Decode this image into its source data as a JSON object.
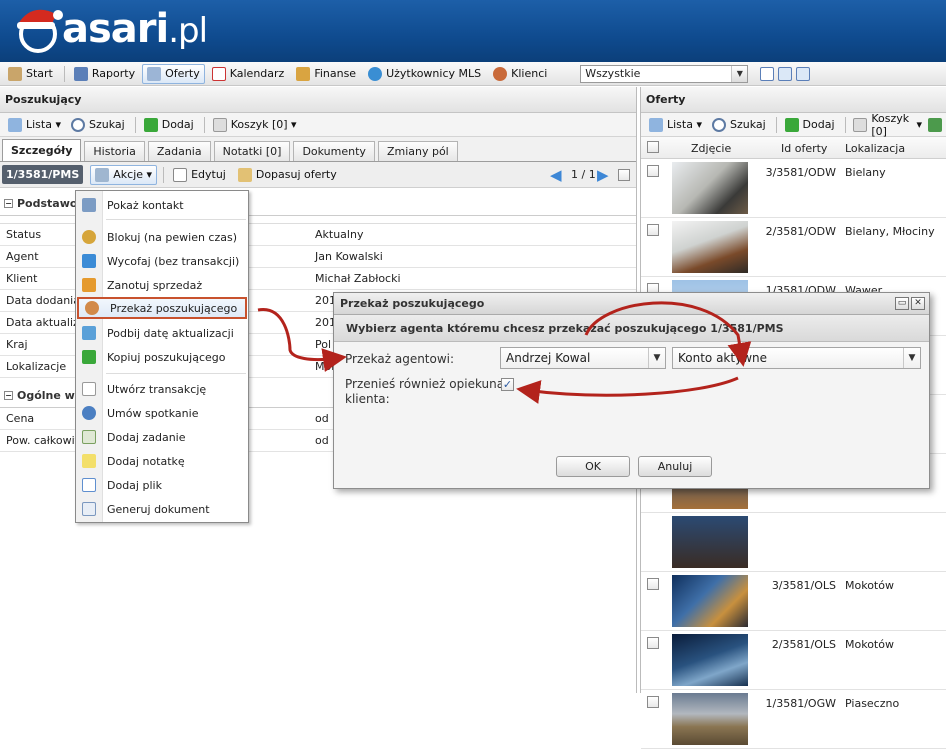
{
  "brand": {
    "logo_main": "asari",
    "logo_suffix": ".pl"
  },
  "topnav": {
    "items": [
      "Start",
      "Raporty",
      "Oferty",
      "Kalendarz",
      "Finanse",
      "Użytkownicy MLS",
      "Klienci"
    ],
    "filter_value": "Wszystkie"
  },
  "left": {
    "title": "Poszukujący",
    "toolbar": {
      "lista": "Lista",
      "szukaj": "Szukaj",
      "dodaj": "Dodaj",
      "koszyk": "Koszyk [0]"
    },
    "tabs": [
      "Szczegóły",
      "Historia",
      "Zadania",
      "Notatki [0]",
      "Dokumenty",
      "Zmiany pól"
    ],
    "subbar": {
      "id": "1/3581/PMS",
      "akcje": "Akcje",
      "edytuj": "Edytuj",
      "dopasuj": "Dopasuj oferty",
      "pager": "1 / 1"
    },
    "section1": "Podstawowe",
    "rows": [
      {
        "k": "Status",
        "v": "Aktualny"
      },
      {
        "k": "Agent",
        "v": "Jan Kowalski"
      },
      {
        "k": "Klient",
        "v": "Michał Zabłocki"
      },
      {
        "k": "Data dodania",
        "v": "201"
      },
      {
        "k": "Data aktualizacji",
        "v": "201"
      },
      {
        "k": "Kraj",
        "v": "Pol"
      },
      {
        "k": "Lokalizacje",
        "v": "Mok"
      }
    ],
    "section2": "Ogólne wa",
    "rows2": [
      {
        "k": "Cena",
        "v": "od 1"
      },
      {
        "k": "Pow. całkowita",
        "v": "od 1"
      }
    ]
  },
  "menu": {
    "items": [
      "Pokaż kontakt",
      "Blokuj (na pewien czas)",
      "Wycofaj (bez transakcji)",
      "Zanotuj sprzedaż",
      "Przekaż poszukującego",
      "Podbij datę aktualizacji",
      "Kopiuj poszukującego",
      "Utwórz transakcję",
      "Umów spotkanie",
      "Dodaj zadanie",
      "Dodaj notatkę",
      "Dodaj plik",
      "Generuj dokument"
    ]
  },
  "right": {
    "title": "Oferty",
    "toolbar": {
      "lista": "Lista",
      "szukaj": "Szukaj",
      "dodaj": "Dodaj",
      "koszyk": "Koszyk [0]"
    },
    "columns": [
      "Zdjęcie",
      "Id oferty",
      "Lokalizacja"
    ],
    "rows": [
      {
        "id": "3/3581/ODW",
        "loc": "Bielany"
      },
      {
        "id": "2/3581/ODW",
        "loc": "Bielany, Młociny"
      },
      {
        "id": "1/3581/ODW",
        "loc": "Wawer"
      },
      {
        "id": "3/3581/OLS",
        "loc": "Mokotów"
      },
      {
        "id": "2/3581/OLS",
        "loc": "Mokotów"
      },
      {
        "id": "1/3581/OGW",
        "loc": "Piaseczno"
      }
    ]
  },
  "dialog": {
    "title": "Przekaż poszukującego",
    "heading": "Wybierz agenta któremu chcesz przekazać poszukującego 1/3581/PMS",
    "agent_label": "Przekaż agentowi:",
    "agent_value": "Andrzej Kowal",
    "account_value": "Konto aktywne",
    "checkbox_label_1": "Przenieś również opiekuna",
    "checkbox_label_2": "klienta:",
    "ok": "OK",
    "cancel": "Anuluj"
  },
  "colors": {
    "header": "#0f4b8f",
    "highlight": "#c8522e",
    "arrow": "#b3231c"
  }
}
